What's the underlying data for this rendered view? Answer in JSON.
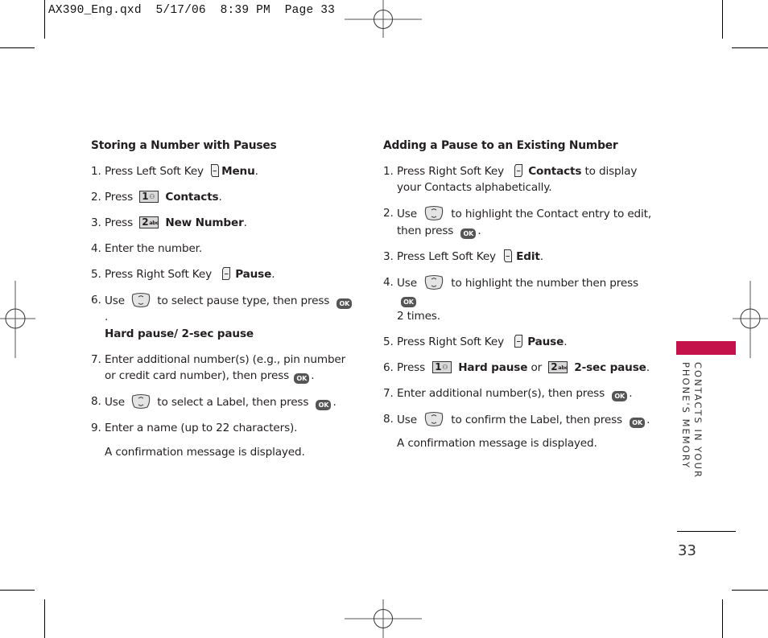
{
  "slug": "AX390_Eng.qxd  5/17/06  8:39 PM  Page 33",
  "left_section": {
    "heading": "Storing a Number with Pauses",
    "steps": [
      {
        "num": "1.",
        "pre": "Press Left Soft Key",
        "icon": "left-soft-key-icon",
        "bold": "Menu",
        "post": "."
      },
      {
        "num": "2.",
        "pre": "Press",
        "key": {
          "digit": "1",
          "sub": "⚇"
        },
        "bold": "Contacts",
        "post": "."
      },
      {
        "num": "3.",
        "pre": "Press",
        "key": {
          "digit": "2",
          "sub": "abc"
        },
        "bold": "New Number",
        "post": "."
      },
      {
        "num": "4.",
        "text": "Enter the number."
      },
      {
        "num": "5.",
        "pre": "Press Right Soft Key",
        "icon": "right-soft-key-icon",
        "bold": "Pause",
        "post": "."
      },
      {
        "num": "6.",
        "pre": "Use",
        "mid": "to select pause type, then press",
        "ok": "OK",
        "post": ".",
        "line2": "Hard pause/ 2-sec pause"
      },
      {
        "num": "7.",
        "text": "Enter additional number(s) (e.g., pin number or credit card number), then press",
        "ok": "OK",
        "post": "."
      },
      {
        "num": "8.",
        "pre": "Use",
        "mid": "to select a Label, then press",
        "ok": "OK",
        "post": "."
      },
      {
        "num": "9.",
        "text": "Enter a name (up to 22 characters)."
      },
      {
        "text": "A confirmation message is displayed."
      }
    ]
  },
  "right_section": {
    "heading": "Adding a Pause to an Existing Number",
    "steps": [
      {
        "num": "1.",
        "pre": "Press Right Soft Key",
        "bold": "Contacts",
        "post": "to display your Contacts alphabetically."
      },
      {
        "num": "2.",
        "pre": "Use",
        "mid": "to highlight the Contact entry to edit, then press",
        "ok": "OK",
        "post": "."
      },
      {
        "num": "3.",
        "pre": "Press Left Soft Key",
        "bold": "Edit",
        "post": "."
      },
      {
        "num": "4.",
        "pre": "Use",
        "mid": "to highlight the number then press",
        "ok": "OK",
        "post": "2 times."
      },
      {
        "num": "5.",
        "pre": "Press Right Soft Key",
        "bold": "Pause",
        "post": "."
      },
      {
        "num": "6.",
        "pre": "Press",
        "key1": {
          "digit": "1",
          "sub": "⚇"
        },
        "bold1": "Hard pause",
        "or": "or",
        "key2": {
          "digit": "2",
          "sub": "abc"
        },
        "bold2": "2-sec pause",
        "post": "."
      },
      {
        "num": "7.",
        "text": "Enter additional number(s), then press",
        "ok": "OK",
        "post": "."
      },
      {
        "num": "8.",
        "pre": "Use",
        "mid": "to confirm the Label, then press",
        "ok": "OK",
        "post": "."
      },
      {
        "text": "A confirmation message is displayed."
      }
    ]
  },
  "sidebar": {
    "line1": "CONTACTS IN YOUR",
    "line2": "PHONE'S MEMORY",
    "accent_color": "#c4104b"
  },
  "page_number": "33"
}
